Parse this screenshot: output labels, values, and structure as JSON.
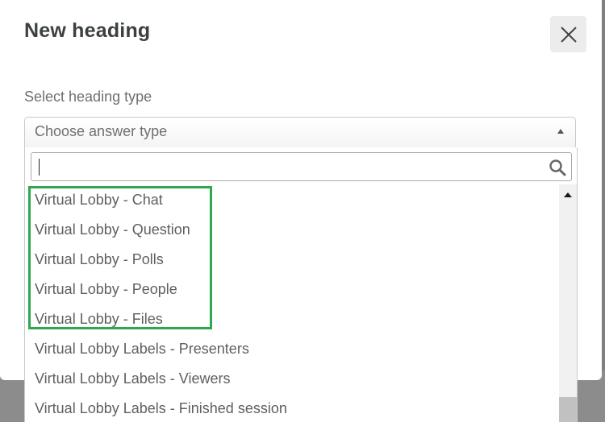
{
  "dialog": {
    "title": "New heading",
    "close_icon": "close-icon"
  },
  "field": {
    "label": "Select heading type",
    "placeholder": "Choose answer type"
  },
  "dropdown": {
    "search_value": "",
    "search_icon": "search-icon",
    "options": [
      "Virtual Lobby - Chat",
      "Virtual Lobby - Question",
      "Virtual Lobby - Polls",
      "Virtual Lobby - People",
      "Virtual Lobby - Files",
      "Virtual Lobby Labels - Presenters",
      "Virtual Lobby Labels - Viewers",
      "Virtual Lobby Labels - Finished session"
    ],
    "highlight_color": "#2ea84f"
  }
}
